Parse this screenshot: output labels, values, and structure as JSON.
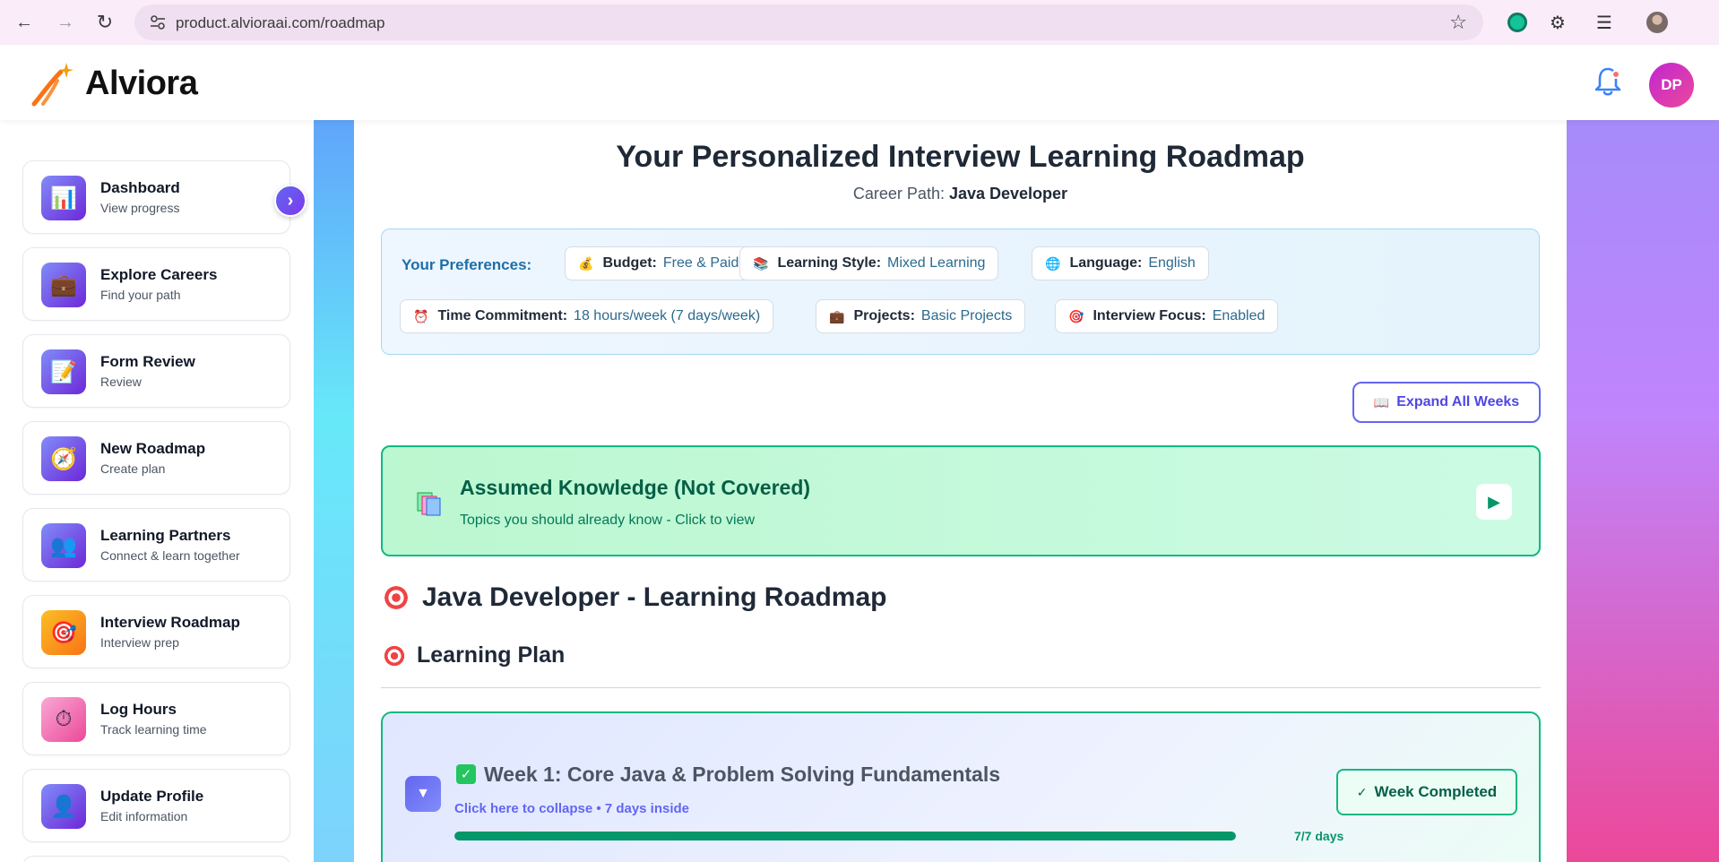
{
  "browser": {
    "url": "product.alvioraai.com/roadmap"
  },
  "header": {
    "brand": "Alviora",
    "avatar_initials": "DP",
    "notification_dot_color": "#f87171"
  },
  "sidebar": {
    "items": [
      {
        "title": "Dashboard",
        "subtitle": "View progress",
        "icon": "bar-chart-icon"
      },
      {
        "title": "Explore Careers",
        "subtitle": "Find your path",
        "icon": "briefcase-icon"
      },
      {
        "title": "Form Review",
        "subtitle": "Review",
        "icon": "memo-icon"
      },
      {
        "title": "New Roadmap",
        "subtitle": "Create plan",
        "icon": "compass-icon"
      },
      {
        "title": "Learning Partners",
        "subtitle": "Connect & learn together",
        "icon": "people-icon"
      },
      {
        "title": "Interview Roadmap",
        "subtitle": "Interview prep",
        "icon": "target-icon"
      },
      {
        "title": "Log Hours",
        "subtitle": "Track learning time",
        "icon": "stopwatch-icon"
      },
      {
        "title": "Update Profile",
        "subtitle": "Edit information",
        "icon": "user-icon"
      }
    ]
  },
  "main": {
    "title": "Your Personalized Interview Learning Roadmap",
    "career_path_label": "Career Path:",
    "career_path_value": "Java Developer",
    "preferences": {
      "label": "Your Preferences:",
      "budget": {
        "key": "Budget:",
        "value": "Free & Paid",
        "icon": "money-bag-icon"
      },
      "learning_style": {
        "key": "Learning Style:",
        "value": "Mixed Learning",
        "icon": "books-icon"
      },
      "language": {
        "key": "Language:",
        "value": "English",
        "icon": "globe-icon"
      },
      "time": {
        "key": "Time Commitment:",
        "value": "18 hours/week (7 days/week)",
        "icon": "alarm-clock-icon"
      },
      "projects": {
        "key": "Projects:",
        "value": "Basic Projects",
        "icon": "briefcase-icon"
      },
      "interview": {
        "key": "Interview Focus:",
        "value": "Enabled",
        "icon": "target-icon"
      }
    },
    "expand_all_label": "Expand All Weeks",
    "assumed": {
      "title": "Assumed Knowledge (Not Covered)",
      "subtitle": "Topics you should already know - Click to view"
    },
    "roadmap_title": "Java Developer - Learning Roadmap",
    "plan_title": "Learning Plan",
    "weeks": [
      {
        "title": "Week 1: Core Java & Problem Solving Fundamentals",
        "subtitle": "Click here to collapse • 7 days inside",
        "progress_label": "7/7 days",
        "progress_fraction": 1.0,
        "status_label": "Week Completed"
      }
    ]
  }
}
